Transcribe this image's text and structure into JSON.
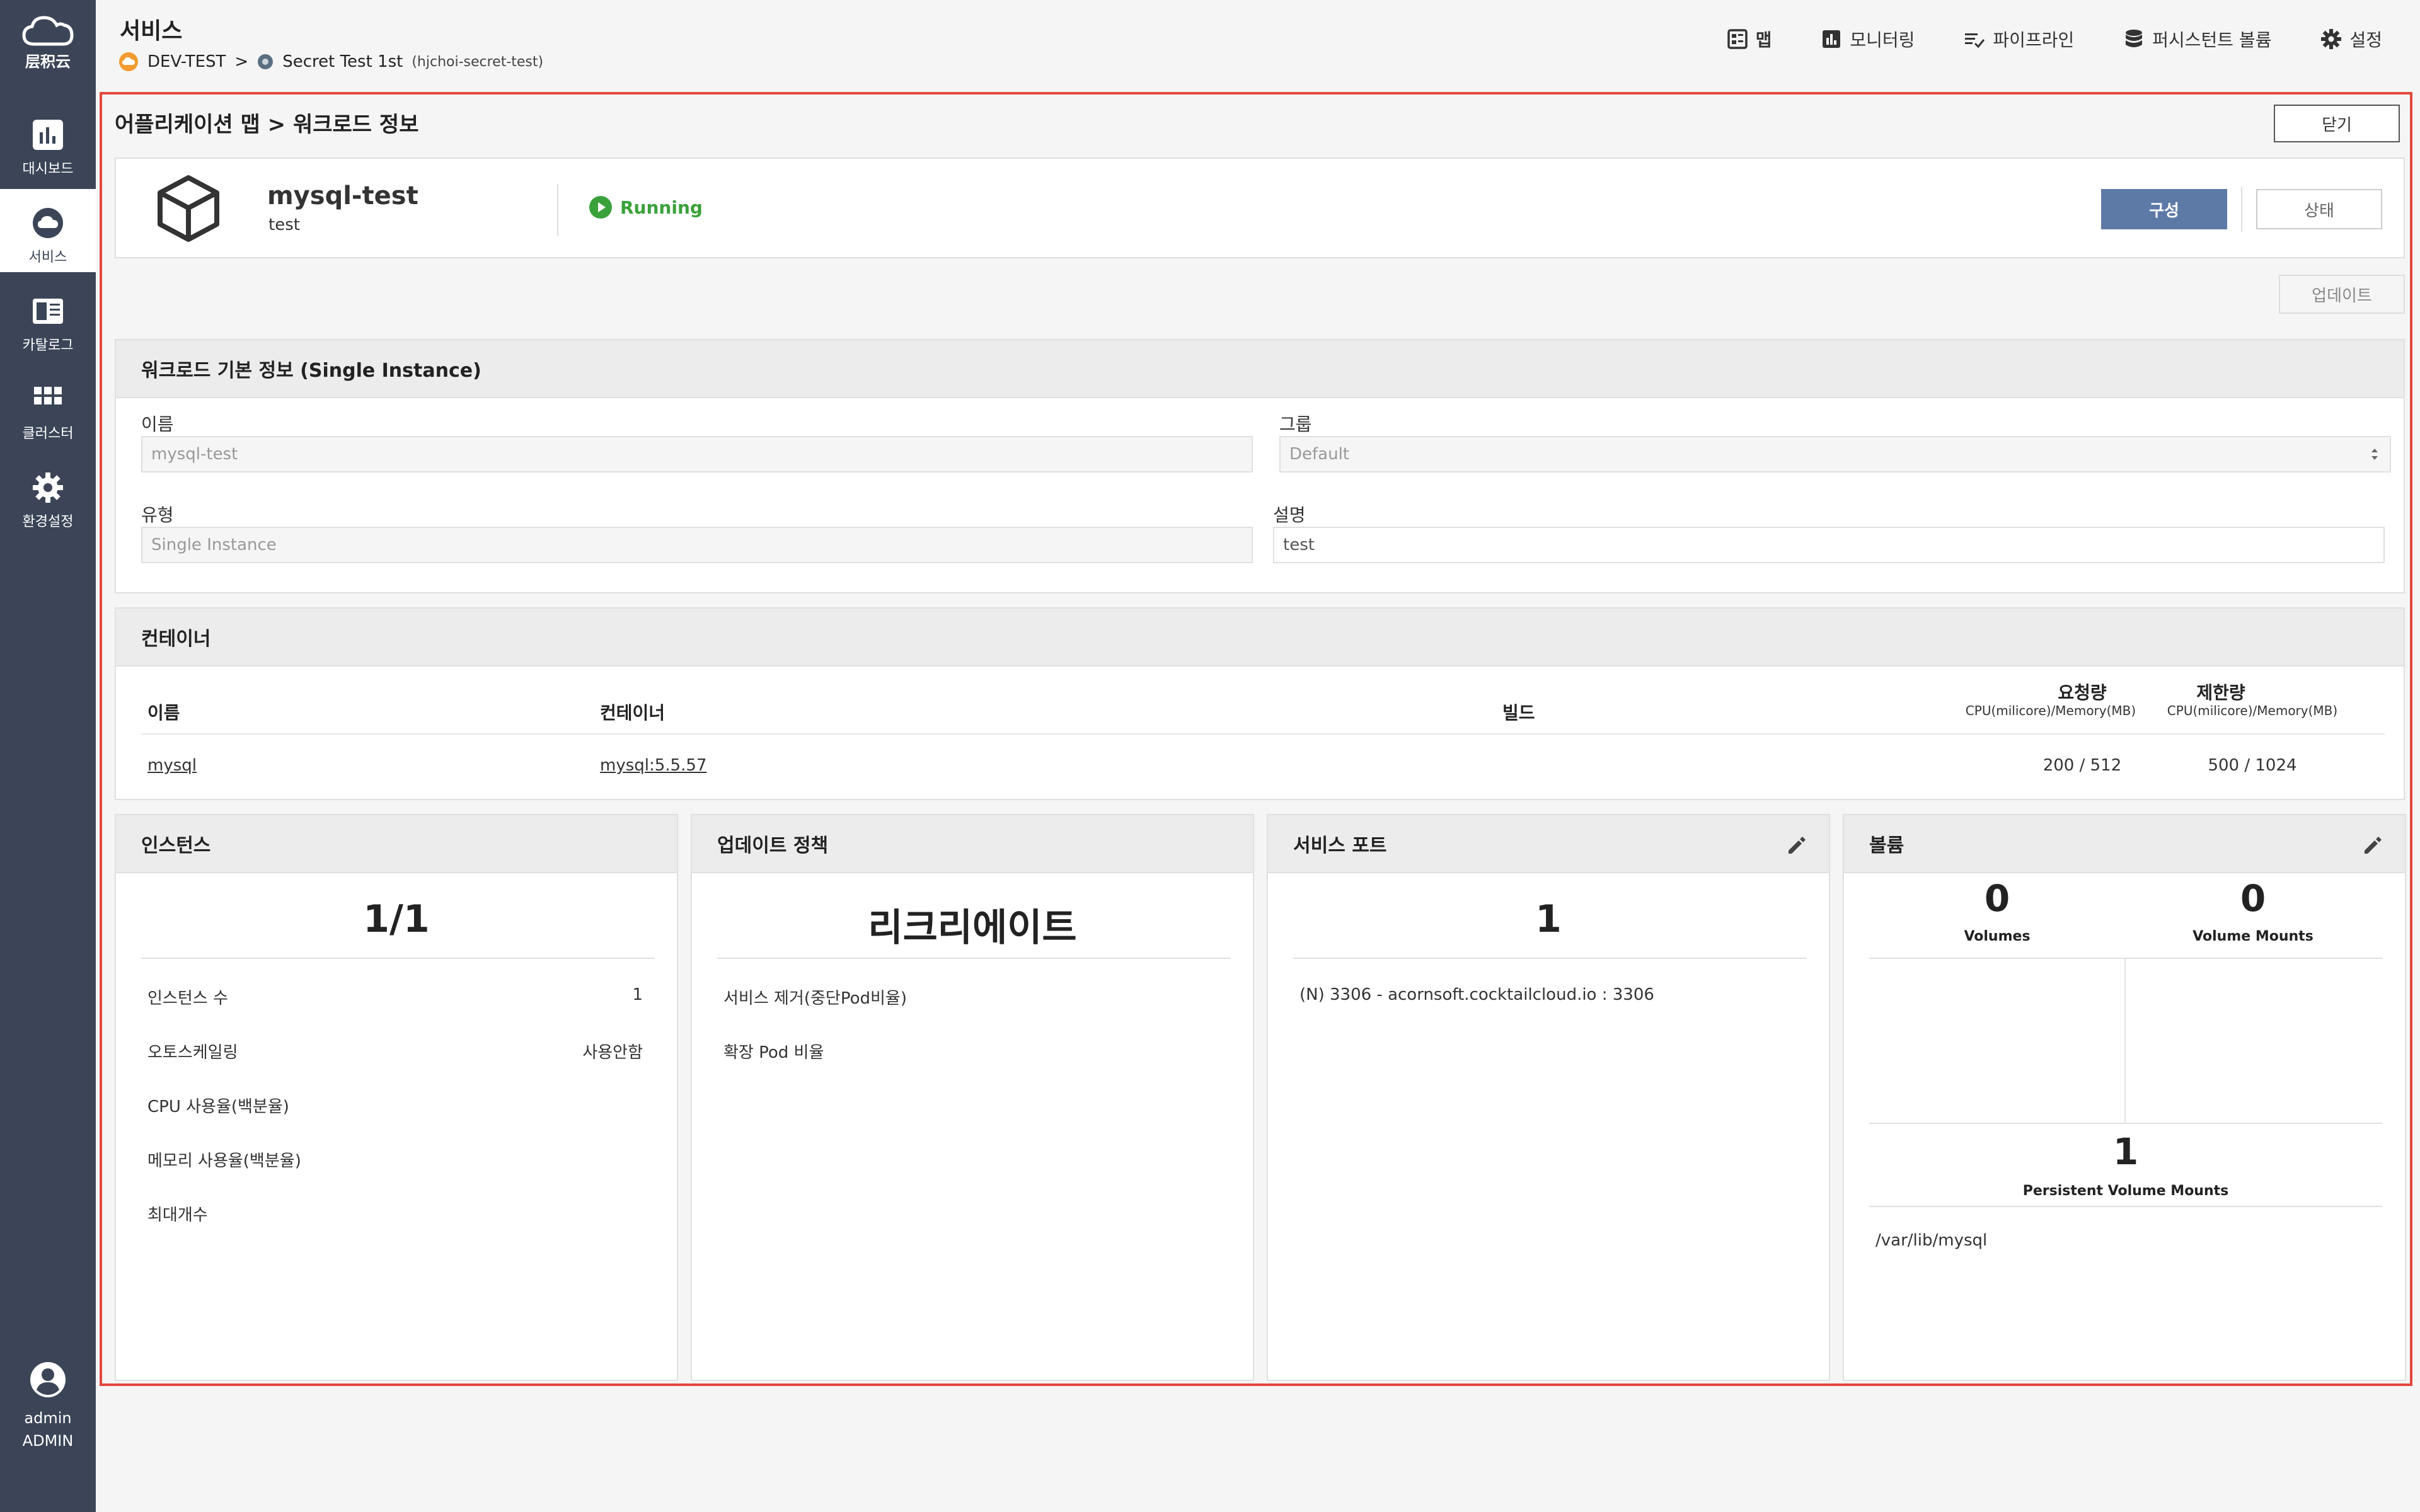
{
  "sidebar": {
    "logo_text": "层积云",
    "items": [
      {
        "label": "대시보드",
        "icon": "dashboard-icon"
      },
      {
        "label": "서비스",
        "icon": "cloud-icon",
        "active": true
      },
      {
        "label": "카탈로그",
        "icon": "catalog-icon"
      },
      {
        "label": "클러스터",
        "icon": "cluster-icon"
      },
      {
        "label": "환경설정",
        "icon": "gear-icon"
      }
    ],
    "user": {
      "name": "admin",
      "role": "ADMIN"
    }
  },
  "header": {
    "title": "서비스",
    "breadcrumb": {
      "env": "DEV-TEST",
      "separator": ">",
      "service": "Secret Test 1st",
      "service_id": "(hjchoi-secret-test)"
    },
    "nav": [
      "맵",
      "모니터링",
      "파이프라인",
      "퍼시스턴트 볼륨",
      "설정"
    ]
  },
  "panel": {
    "title": "어플리케이션 맵 > 워크로드 정보",
    "close_label": "닫기",
    "workload": {
      "name": "mysql-test",
      "group": "test",
      "status": "Running"
    },
    "config_label": "구성",
    "state_label": "상태",
    "update_label": "업데이트"
  },
  "basic_info": {
    "title": "워크로드 기본 정보 (Single Instance)",
    "name_label": "이름",
    "name_value": "mysql-test",
    "group_label": "그룹",
    "group_value": "Default",
    "type_label": "유형",
    "type_value": "Single Instance",
    "desc_label": "설명",
    "desc_value": "test"
  },
  "containers": {
    "title": "컨테이너",
    "headers": {
      "name": "이름",
      "container": "컨테이너",
      "build": "빌드",
      "request": "요청량",
      "limit": "제한량",
      "unit": "CPU(milicore)/Memory(MB)"
    },
    "rows": [
      {
        "name": "mysql",
        "image": "mysql:5.5.57",
        "build": "",
        "request": "200 / 512",
        "limit": "500 / 1024"
      }
    ]
  },
  "instances": {
    "title": "인스턴스",
    "value": "1/1",
    "rows": [
      {
        "label": "인스턴스 수",
        "value": "1"
      },
      {
        "label": "오토스케일링",
        "value": "사용안함"
      },
      {
        "label": "CPU 사용율(백분율)",
        "value": ""
      },
      {
        "label": "메모리 사용율(백분율)",
        "value": ""
      },
      {
        "label": "최대개수",
        "value": ""
      }
    ]
  },
  "update_policy": {
    "title": "업데이트 정책",
    "value": "리크리에이트",
    "rows": [
      {
        "label": "서비스 제거(중단Pod비율)"
      },
      {
        "label": "확장 Pod 비율"
      }
    ]
  },
  "service_ports": {
    "title": "서비스 포트",
    "value": "1",
    "rows": [
      {
        "label": "(N) 3306 - acornsoft.cocktailcloud.io : 3306"
      }
    ]
  },
  "volumes": {
    "title": "볼륨",
    "volumes_count": "0",
    "volumes_label": "Volumes",
    "mounts_count": "0",
    "mounts_label": "Volume Mounts",
    "pv_count": "1",
    "pv_label": "Persistent Volume Mounts",
    "paths": [
      "/var/lib/mysql"
    ]
  },
  "colors": {
    "accent": "#5d79a6",
    "sidebar": "#3b4557",
    "highlight": "#e2483d",
    "running": "#3aa13a"
  }
}
